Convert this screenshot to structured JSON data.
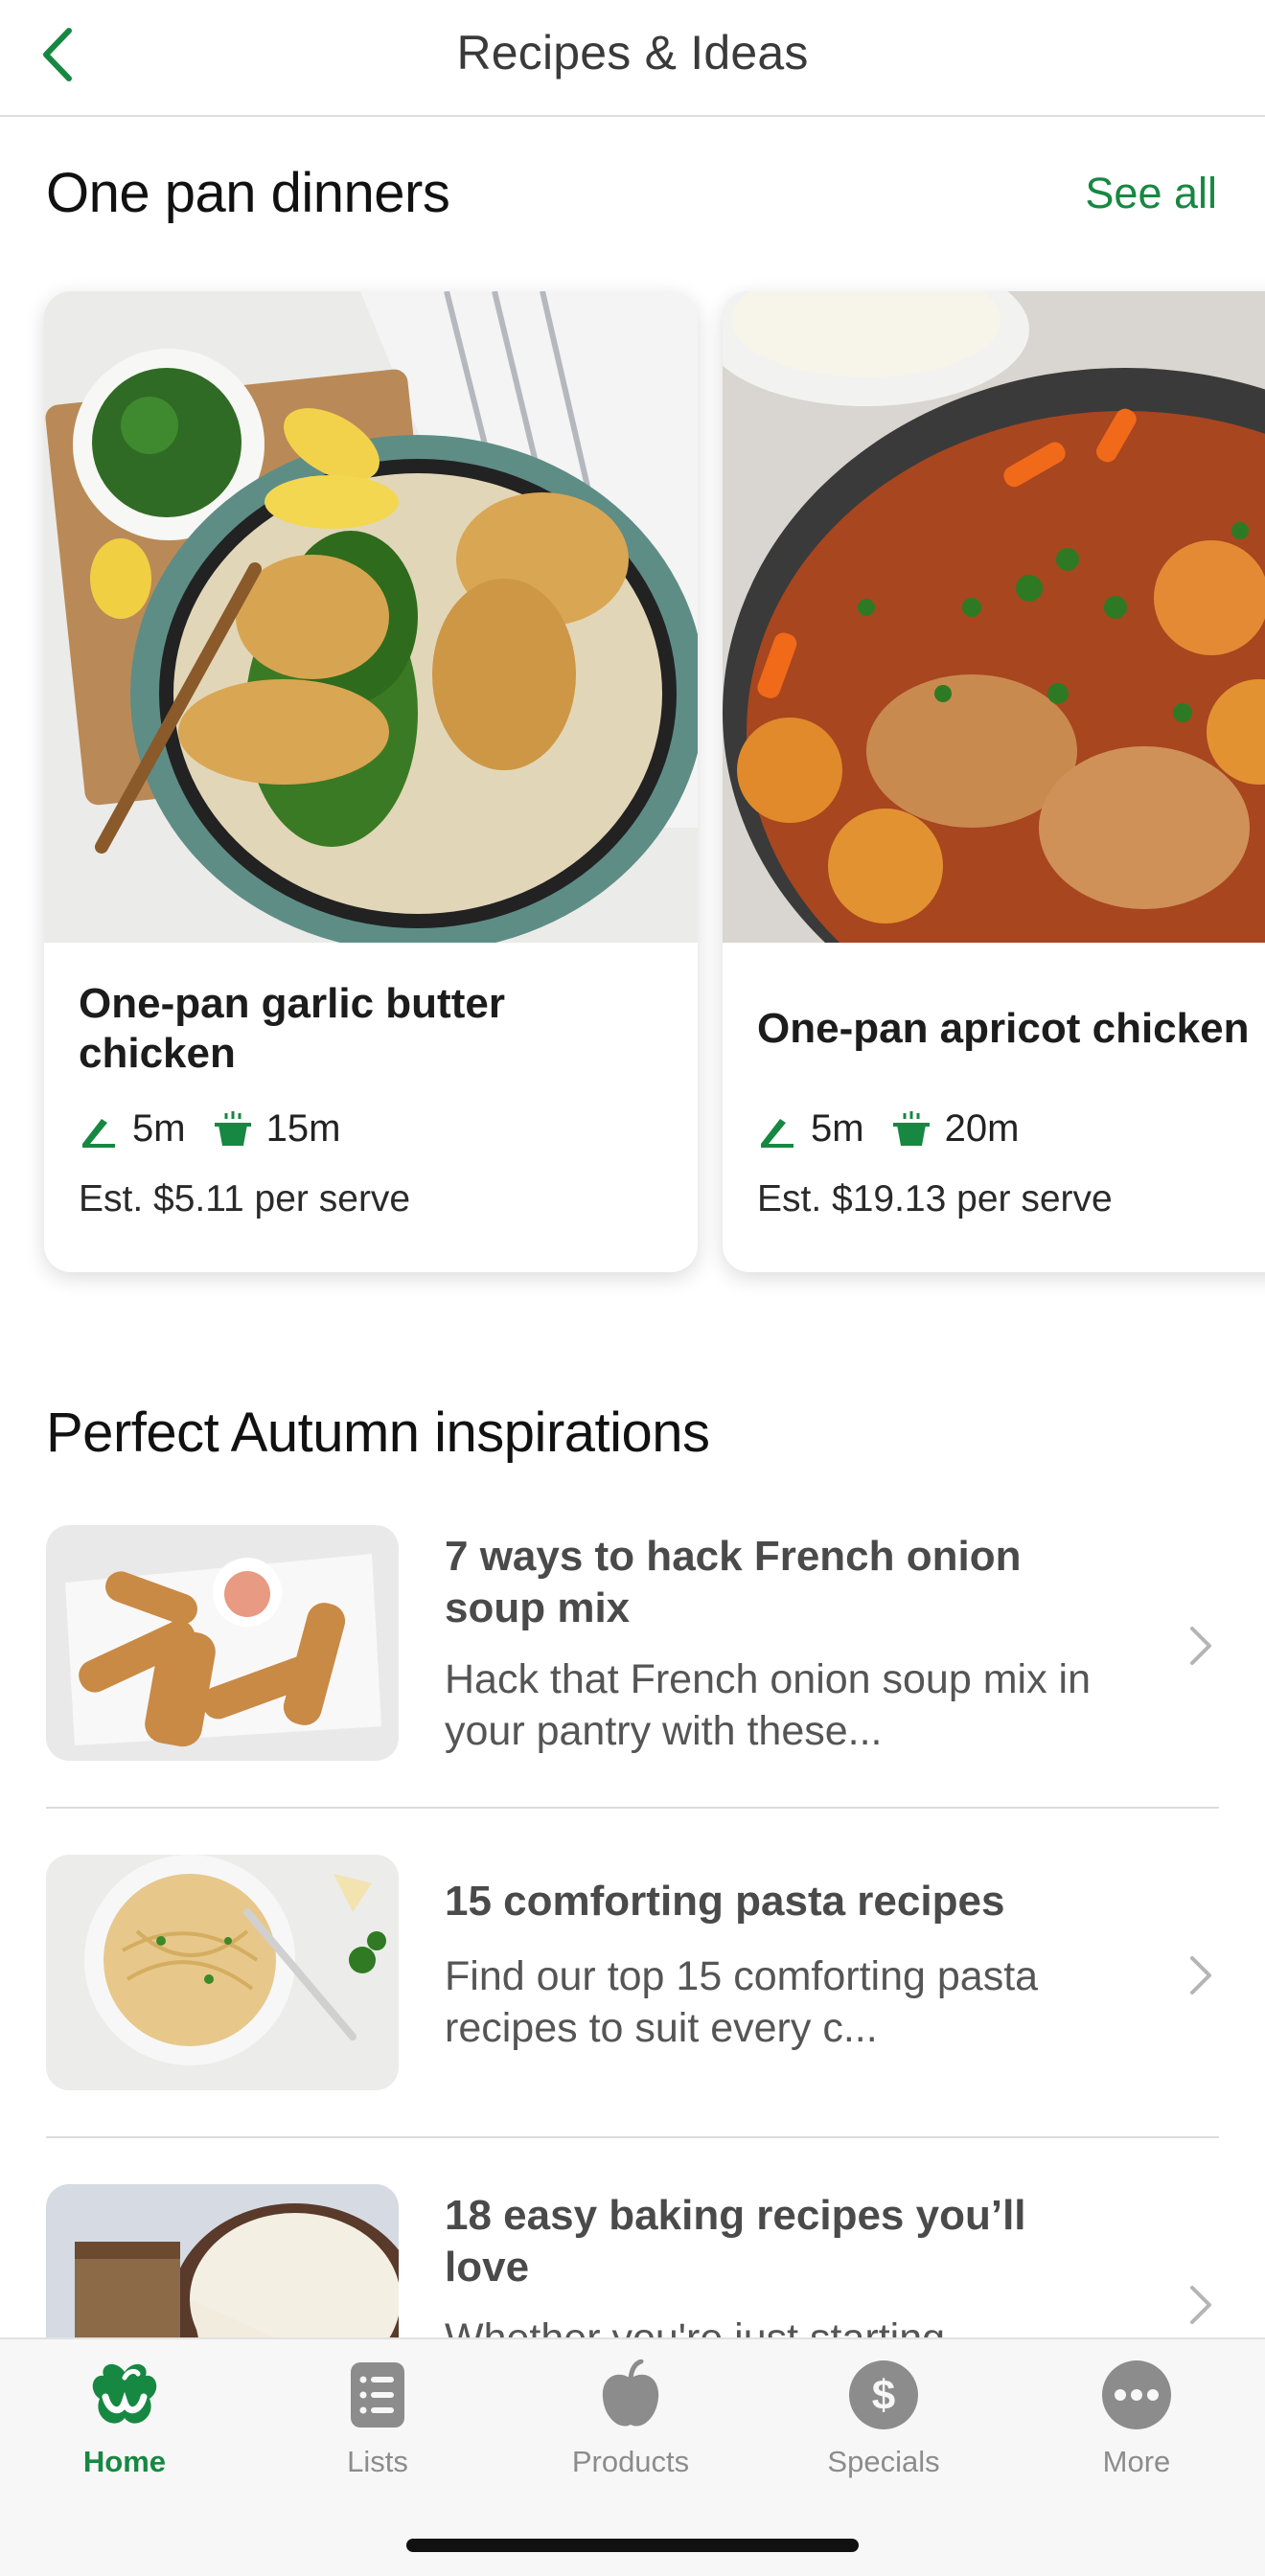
{
  "header": {
    "title": "Recipes & Ideas",
    "back_icon": "chevron-left-icon"
  },
  "section_one": {
    "title": "One pan dinners",
    "see_all": "See all",
    "cards": [
      {
        "title": "One-pan garlic butter chicken",
        "prep": "5m",
        "cook": "15m",
        "price": "Est. $5.11 per serve"
      },
      {
        "title": "One-pan apricot chicken",
        "prep": "5m",
        "cook": "20m",
        "price": "Est. $19.13 per serve"
      }
    ]
  },
  "section_two": {
    "title": "Perfect Autumn inspirations",
    "items": [
      {
        "title": "7 ways to hack French onion soup mix",
        "desc": "Hack that French onion soup mix in your pantry with these..."
      },
      {
        "title": "15 comforting pasta recipes",
        "desc": "Find our top 15 comforting pasta recipes to suit every c..."
      },
      {
        "title": "18 easy baking recipes you’ll love",
        "desc": "Whether you're just starting..."
      }
    ]
  },
  "tabs": [
    {
      "label": "Home",
      "icon": "woolworths-logo-icon",
      "active": true
    },
    {
      "label": "Lists",
      "icon": "list-icon",
      "active": false
    },
    {
      "label": "Products",
      "icon": "apple-icon",
      "active": false
    },
    {
      "label": "Specials",
      "icon": "dollar-icon",
      "active": false
    },
    {
      "label": "More",
      "icon": "more-dots-icon",
      "active": false
    }
  ],
  "colors": {
    "accent": "#178841",
    "inactive": "#8c8c8c"
  }
}
